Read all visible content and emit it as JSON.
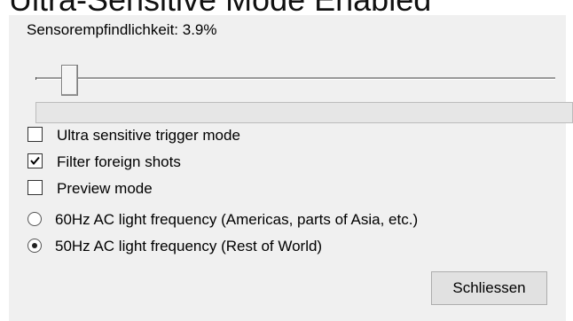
{
  "header_strip_text": "Ultra-Sensitive Mode Enabled",
  "sensitivity": {
    "label": "Sensorempfindlichkeit: 3.9%",
    "value_percent": 3.9
  },
  "progress": {
    "level_percent": 0
  },
  "checkboxes": [
    {
      "label": "Ultra sensitive trigger mode",
      "checked": false
    },
    {
      "label": "Filter foreign shots",
      "checked": true
    },
    {
      "label": "Preview mode",
      "checked": false
    }
  ],
  "radios": [
    {
      "label": "60Hz AC light frequency (Americas, parts of Asia, etc.)",
      "selected": false
    },
    {
      "label": "50Hz AC light frequency (Rest of World)",
      "selected": true
    }
  ],
  "buttons": {
    "close_label": "Schliessen"
  },
  "colors": {
    "background": "#f0f0f0",
    "progress_fill": "#06b025"
  }
}
